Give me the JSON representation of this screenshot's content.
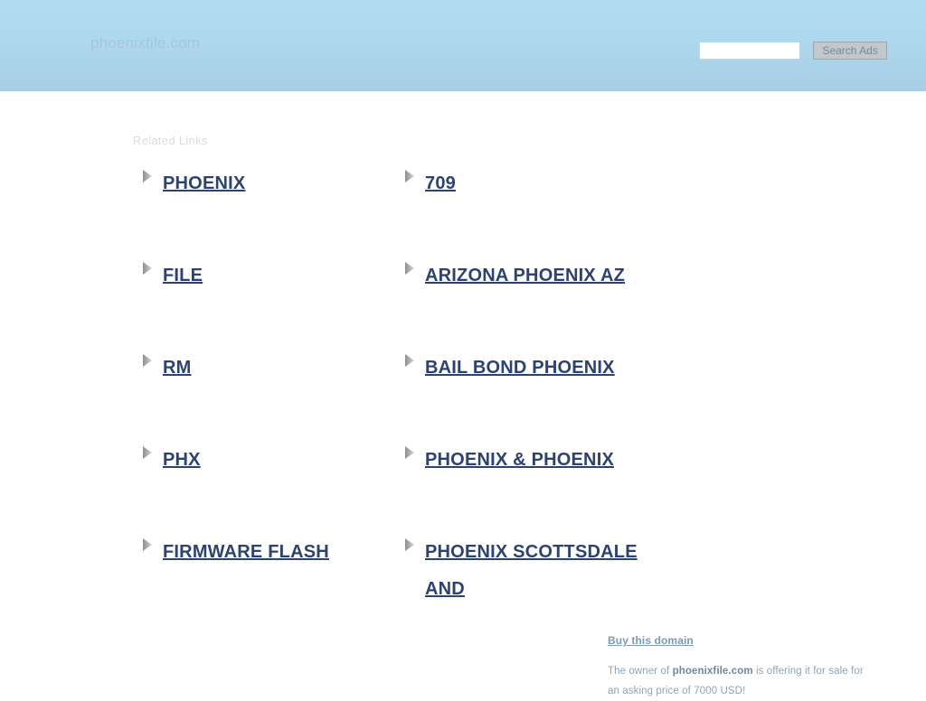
{
  "header": {
    "site_title": "phoenixfile.com",
    "gradient_top": "#b3dcf0",
    "gradient_bottom": "#a6cde4",
    "title_color": "#a8c4d8",
    "search": {
      "value": "",
      "placeholder": "",
      "button_label": "Search Ads",
      "button_bg": "#c3c7c9",
      "button_text_color": "#6f8ba3"
    }
  },
  "main": {
    "related_links_label": "Related Links",
    "label_color": "#dcdcdc",
    "link_color": "#2c4270",
    "arrow_icon": "triangle-right-icon",
    "rows": [
      {
        "left": {
          "label": "PHOENIX"
        },
        "right": {
          "label": "709"
        }
      },
      {
        "left": {
          "label": "FILE"
        },
        "right": {
          "label": "ARIZONA PHOENIX AZ"
        }
      },
      {
        "left": {
          "label": "RM"
        },
        "right": {
          "label": "BAIL BOND PHOENIX"
        }
      },
      {
        "left": {
          "label": "PHX"
        },
        "right": {
          "label": "PHOENIX & PHOENIX"
        }
      },
      {
        "left": {
          "label": "FIRMWARE FLASH"
        },
        "right": {
          "label": "PHOENIX SCOTTSDALE AND"
        }
      }
    ]
  },
  "footer": {
    "buy_link_label": "Buy this domain",
    "buy_link_color": "#7b9bb3",
    "note_prefix": "The owner of ",
    "note_domain": "phoenixfile.com",
    "note_suffix": " is offering it for sale for an asking price of 7000 USD!",
    "note_color": "#8ba5b8"
  }
}
